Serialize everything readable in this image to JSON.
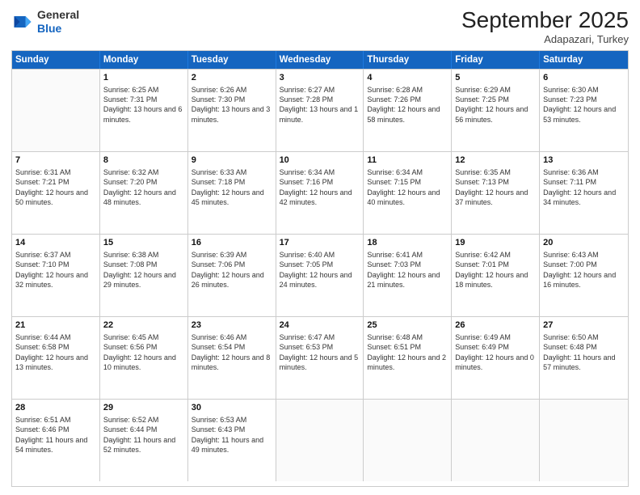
{
  "logo": {
    "general": "General",
    "blue": "Blue"
  },
  "header": {
    "month": "September 2025",
    "location": "Adapazari, Turkey"
  },
  "weekdays": [
    "Sunday",
    "Monday",
    "Tuesday",
    "Wednesday",
    "Thursday",
    "Friday",
    "Saturday"
  ],
  "rows": [
    [
      {
        "day": "",
        "sunrise": "",
        "sunset": "",
        "daylight": ""
      },
      {
        "day": "1",
        "sunrise": "Sunrise: 6:25 AM",
        "sunset": "Sunset: 7:31 PM",
        "daylight": "Daylight: 13 hours and 6 minutes."
      },
      {
        "day": "2",
        "sunrise": "Sunrise: 6:26 AM",
        "sunset": "Sunset: 7:30 PM",
        "daylight": "Daylight: 13 hours and 3 minutes."
      },
      {
        "day": "3",
        "sunrise": "Sunrise: 6:27 AM",
        "sunset": "Sunset: 7:28 PM",
        "daylight": "Daylight: 13 hours and 1 minute."
      },
      {
        "day": "4",
        "sunrise": "Sunrise: 6:28 AM",
        "sunset": "Sunset: 7:26 PM",
        "daylight": "Daylight: 12 hours and 58 minutes."
      },
      {
        "day": "5",
        "sunrise": "Sunrise: 6:29 AM",
        "sunset": "Sunset: 7:25 PM",
        "daylight": "Daylight: 12 hours and 56 minutes."
      },
      {
        "day": "6",
        "sunrise": "Sunrise: 6:30 AM",
        "sunset": "Sunset: 7:23 PM",
        "daylight": "Daylight: 12 hours and 53 minutes."
      }
    ],
    [
      {
        "day": "7",
        "sunrise": "Sunrise: 6:31 AM",
        "sunset": "Sunset: 7:21 PM",
        "daylight": "Daylight: 12 hours and 50 minutes."
      },
      {
        "day": "8",
        "sunrise": "Sunrise: 6:32 AM",
        "sunset": "Sunset: 7:20 PM",
        "daylight": "Daylight: 12 hours and 48 minutes."
      },
      {
        "day": "9",
        "sunrise": "Sunrise: 6:33 AM",
        "sunset": "Sunset: 7:18 PM",
        "daylight": "Daylight: 12 hours and 45 minutes."
      },
      {
        "day": "10",
        "sunrise": "Sunrise: 6:34 AM",
        "sunset": "Sunset: 7:16 PM",
        "daylight": "Daylight: 12 hours and 42 minutes."
      },
      {
        "day": "11",
        "sunrise": "Sunrise: 6:34 AM",
        "sunset": "Sunset: 7:15 PM",
        "daylight": "Daylight: 12 hours and 40 minutes."
      },
      {
        "day": "12",
        "sunrise": "Sunrise: 6:35 AM",
        "sunset": "Sunset: 7:13 PM",
        "daylight": "Daylight: 12 hours and 37 minutes."
      },
      {
        "day": "13",
        "sunrise": "Sunrise: 6:36 AM",
        "sunset": "Sunset: 7:11 PM",
        "daylight": "Daylight: 12 hours and 34 minutes."
      }
    ],
    [
      {
        "day": "14",
        "sunrise": "Sunrise: 6:37 AM",
        "sunset": "Sunset: 7:10 PM",
        "daylight": "Daylight: 12 hours and 32 minutes."
      },
      {
        "day": "15",
        "sunrise": "Sunrise: 6:38 AM",
        "sunset": "Sunset: 7:08 PM",
        "daylight": "Daylight: 12 hours and 29 minutes."
      },
      {
        "day": "16",
        "sunrise": "Sunrise: 6:39 AM",
        "sunset": "Sunset: 7:06 PM",
        "daylight": "Daylight: 12 hours and 26 minutes."
      },
      {
        "day": "17",
        "sunrise": "Sunrise: 6:40 AM",
        "sunset": "Sunset: 7:05 PM",
        "daylight": "Daylight: 12 hours and 24 minutes."
      },
      {
        "day": "18",
        "sunrise": "Sunrise: 6:41 AM",
        "sunset": "Sunset: 7:03 PM",
        "daylight": "Daylight: 12 hours and 21 minutes."
      },
      {
        "day": "19",
        "sunrise": "Sunrise: 6:42 AM",
        "sunset": "Sunset: 7:01 PM",
        "daylight": "Daylight: 12 hours and 18 minutes."
      },
      {
        "day": "20",
        "sunrise": "Sunrise: 6:43 AM",
        "sunset": "Sunset: 7:00 PM",
        "daylight": "Daylight: 12 hours and 16 minutes."
      }
    ],
    [
      {
        "day": "21",
        "sunrise": "Sunrise: 6:44 AM",
        "sunset": "Sunset: 6:58 PM",
        "daylight": "Daylight: 12 hours and 13 minutes."
      },
      {
        "day": "22",
        "sunrise": "Sunrise: 6:45 AM",
        "sunset": "Sunset: 6:56 PM",
        "daylight": "Daylight: 12 hours and 10 minutes."
      },
      {
        "day": "23",
        "sunrise": "Sunrise: 6:46 AM",
        "sunset": "Sunset: 6:54 PM",
        "daylight": "Daylight: 12 hours and 8 minutes."
      },
      {
        "day": "24",
        "sunrise": "Sunrise: 6:47 AM",
        "sunset": "Sunset: 6:53 PM",
        "daylight": "Daylight: 12 hours and 5 minutes."
      },
      {
        "day": "25",
        "sunrise": "Sunrise: 6:48 AM",
        "sunset": "Sunset: 6:51 PM",
        "daylight": "Daylight: 12 hours and 2 minutes."
      },
      {
        "day": "26",
        "sunrise": "Sunrise: 6:49 AM",
        "sunset": "Sunset: 6:49 PM",
        "daylight": "Daylight: 12 hours and 0 minutes."
      },
      {
        "day": "27",
        "sunrise": "Sunrise: 6:50 AM",
        "sunset": "Sunset: 6:48 PM",
        "daylight": "Daylight: 11 hours and 57 minutes."
      }
    ],
    [
      {
        "day": "28",
        "sunrise": "Sunrise: 6:51 AM",
        "sunset": "Sunset: 6:46 PM",
        "daylight": "Daylight: 11 hours and 54 minutes."
      },
      {
        "day": "29",
        "sunrise": "Sunrise: 6:52 AM",
        "sunset": "Sunset: 6:44 PM",
        "daylight": "Daylight: 11 hours and 52 minutes."
      },
      {
        "day": "30",
        "sunrise": "Sunrise: 6:53 AM",
        "sunset": "Sunset: 6:43 PM",
        "daylight": "Daylight: 11 hours and 49 minutes."
      },
      {
        "day": "",
        "sunrise": "",
        "sunset": "",
        "daylight": ""
      },
      {
        "day": "",
        "sunrise": "",
        "sunset": "",
        "daylight": ""
      },
      {
        "day": "",
        "sunrise": "",
        "sunset": "",
        "daylight": ""
      },
      {
        "day": "",
        "sunrise": "",
        "sunset": "",
        "daylight": ""
      }
    ]
  ]
}
